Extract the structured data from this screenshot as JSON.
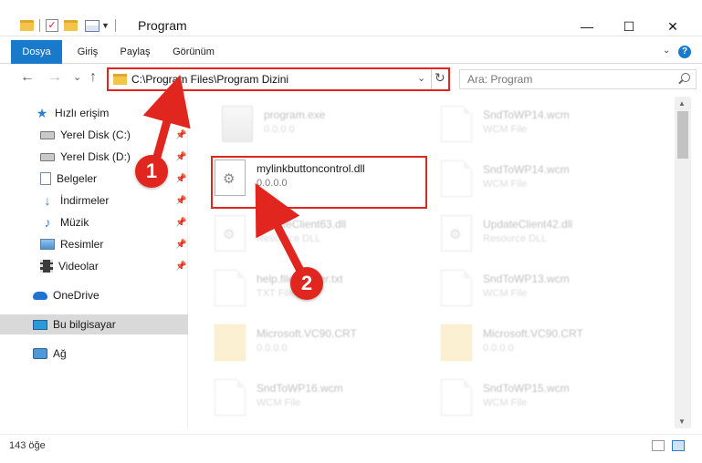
{
  "window": {
    "title": "Program",
    "minimize": "—",
    "maximize": "☐",
    "close": "✕"
  },
  "ribbon": {
    "tabs": [
      "Dosya",
      "Giriş",
      "Paylaş",
      "Görünüm"
    ]
  },
  "nav": {
    "back": "←",
    "forward": "→",
    "recent": "⌄",
    "up": "↑",
    "address": "C:\\Program Files\\Program Dizini",
    "search_placeholder": "Ara: Program"
  },
  "sidebar": {
    "items": [
      {
        "label": "Hızlı erişim",
        "icon": "star-icon"
      },
      {
        "label": "Yerel Disk (C:)",
        "icon": "drive-icon"
      },
      {
        "label": "Yerel Disk (D:)",
        "icon": "drive-icon"
      },
      {
        "label": "Belgeler",
        "icon": "documents-icon"
      },
      {
        "label": "İndirmeler",
        "icon": "download-icon"
      },
      {
        "label": "Müzik",
        "icon": "music-icon"
      },
      {
        "label": "Resimler",
        "icon": "pictures-icon"
      },
      {
        "label": "Videolar",
        "icon": "video-icon"
      },
      {
        "label": "OneDrive",
        "icon": "cloud-icon"
      },
      {
        "label": "Bu bilgisayar",
        "icon": "computer-icon"
      },
      {
        "label": "Ağ",
        "icon": "network-icon"
      }
    ],
    "pin_glyph": "📌"
  },
  "files": [
    {
      "name": "program.exe",
      "sub": "0.0.0.0",
      "icon": "exe-icon"
    },
    {
      "name": "SndToWP14.wcm",
      "sub": "WCM File",
      "icon": "document-icon"
    },
    {
      "name": "mylinkbuttoncontrol.dll",
      "sub": "0.0.0.0",
      "icon": "gear-document-icon"
    },
    {
      "name": "SndToWP14.wcm",
      "sub": "WCM File",
      "icon": "document-icon"
    },
    {
      "name": "UpdateClient63.dll",
      "sub": "Resource DLL",
      "icon": "gear-document-icon"
    },
    {
      "name": "UpdateClient42.dll",
      "sub": "Resource DLL",
      "icon": "gear-document-icon"
    },
    {
      "name": "help.file.reader.txt",
      "sub": "TXT File",
      "icon": "document-icon"
    },
    {
      "name": "SndToWP13.wcm",
      "sub": "WCM File",
      "icon": "document-icon"
    },
    {
      "name": "Microsoft.VC90.CRT",
      "sub": "0.0.0.0",
      "icon": "folder-icon"
    },
    {
      "name": "Microsoft.VC90.CRT",
      "sub": "0.0.0.0",
      "icon": "folder-icon"
    },
    {
      "name": "SndToWP16.wcm",
      "sub": "WCM File",
      "icon": "document-icon"
    },
    {
      "name": "SndToWP15.wcm",
      "sub": "WCM File",
      "icon": "document-icon"
    }
  ],
  "status": {
    "item_count": "143 öğe"
  },
  "callouts": [
    "1",
    "2"
  ],
  "colors": {
    "accent": "#1979ca",
    "highlight": "#e0261f"
  }
}
